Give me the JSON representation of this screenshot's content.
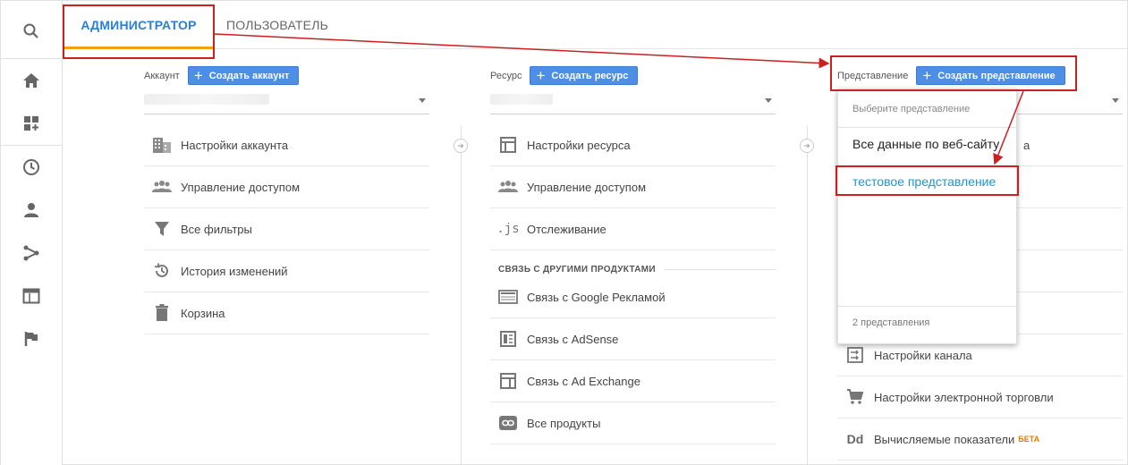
{
  "tabs": {
    "admin": "АДМИНИСТРАТОР",
    "user": "ПОЛЬЗОВАТЕЛЬ"
  },
  "rail_icons": [
    "search-icon",
    "home-icon",
    "dashboard-add-icon",
    "clock-icon",
    "person-icon",
    "flow-icon",
    "window-icon",
    "flag-icon"
  ],
  "account": {
    "label": "Аккаунт",
    "create_button": "Создать аккаунт",
    "items": [
      {
        "label": "Настройки аккаунта",
        "icon": "building-icon"
      },
      {
        "label": "Управление доступом",
        "icon": "people-icon"
      },
      {
        "label": "Все фильтры",
        "icon": "filter-icon"
      },
      {
        "label": "История изменений",
        "icon": "history-icon"
      },
      {
        "label": "Корзина",
        "icon": "trash-icon"
      }
    ]
  },
  "property": {
    "label": "Ресурс",
    "create_button": "Создать ресурс",
    "items": [
      {
        "label": "Настройки ресурса",
        "icon": "layout-icon"
      },
      {
        "label": "Управление доступом",
        "icon": "people-icon"
      },
      {
        "label": "Отслеживание",
        "icon": "js-icon",
        "glyph": ".js"
      }
    ],
    "section_label": "СВЯЗЬ С ДРУГИМИ ПРОДУКТАМИ",
    "linked_items": [
      {
        "label": "Связь с Google Рекламой",
        "icon": "ads-icon"
      },
      {
        "label": "Связь с AdSense",
        "icon": "adsense-icon"
      },
      {
        "label": "Связь с Ad Exchange",
        "icon": "adexchange-icon"
      },
      {
        "label": "Все продукты",
        "icon": "link-icon"
      }
    ]
  },
  "view": {
    "label": "Представление",
    "create_button": "Создать представление",
    "items": [
      {
        "label": "Настройки канала",
        "icon": "channel-icon"
      },
      {
        "label": "Настройки электронной торговли",
        "icon": "cart-icon"
      },
      {
        "label": "Вычисляемые показатели",
        "icon": "dd-icon",
        "glyph": "Dd",
        "badge": "БЕТА"
      }
    ],
    "dropdown": {
      "placeholder": "Выберите представление",
      "options": [
        "Все данные по веб-сайту",
        "тестовое представление"
      ],
      "selected_index": 1,
      "footer": "2 представления",
      "hidden_suffix": "а"
    }
  },
  "colors": {
    "accent": "#2a7fd4",
    "tab_underline": "#f0a30a",
    "button": "#4d8ee6",
    "highlight": "#cc1f1f",
    "selected_option": "#1f94d6",
    "beta": "#e07b00"
  }
}
